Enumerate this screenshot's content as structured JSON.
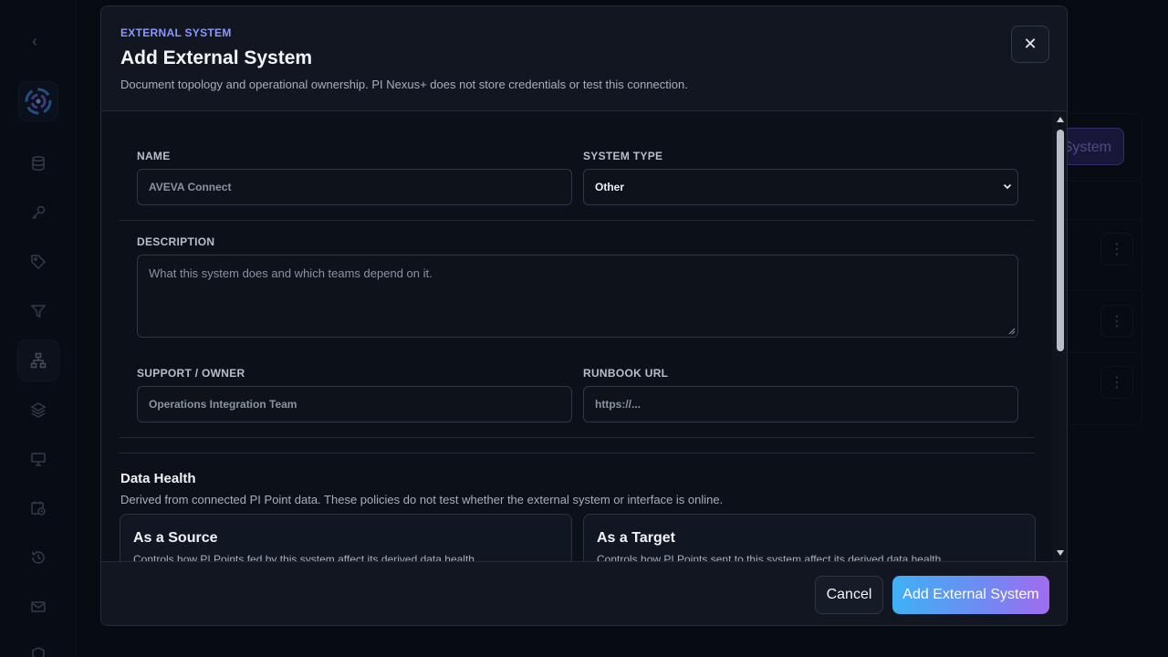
{
  "background": {
    "primary_button_label": "System",
    "accent": "#5b4fb8"
  },
  "sidebar": {
    "icons": [
      "chevron-left-icon",
      "logo-icon",
      "database-icon",
      "key-icon",
      "tag-icon",
      "filter-icon",
      "network-icon",
      "layers-icon",
      "monitor-icon",
      "calendar-clock-icon",
      "history-icon",
      "mail-icon",
      "shield-icon"
    ],
    "active": "network-icon"
  },
  "modal": {
    "eyebrow": "EXTERNAL SYSTEM",
    "title": "Add External System",
    "subtitle": "Document topology and operational ownership. PI Nexus+ does not store credentials or test this connection.",
    "close_label": "✕",
    "form": {
      "name_label": "NAME",
      "name_placeholder": "AVEVA Connect",
      "system_type_label": "SYSTEM TYPE",
      "system_type_value": "Other",
      "description_label": "DESCRIPTION",
      "description_placeholder": "What this system does and which teams depend on it.",
      "owner_label": "SUPPORT / OWNER",
      "owner_placeholder": "Operations Integration Team",
      "runbook_label": "RUNBOOK URL",
      "runbook_placeholder": "https://..."
    },
    "data_health": {
      "title": "Data Health",
      "subtitle": "Derived from connected PI Point data. These policies do not test whether the external system or interface is online.",
      "cards": [
        {
          "title": "As a Source",
          "description": "Controls how PI Points fed by this system affect its derived data health."
        },
        {
          "title": "As a Target",
          "description": "Controls how PI Points sent to this system affect its derived data health."
        }
      ]
    },
    "footer": {
      "cancel_label": "Cancel",
      "submit_label": "Add External System"
    }
  },
  "colors": {
    "accent": "#8e96ff",
    "gradient_start": "#3fb1f5",
    "gradient_end": "#a06bf0"
  }
}
